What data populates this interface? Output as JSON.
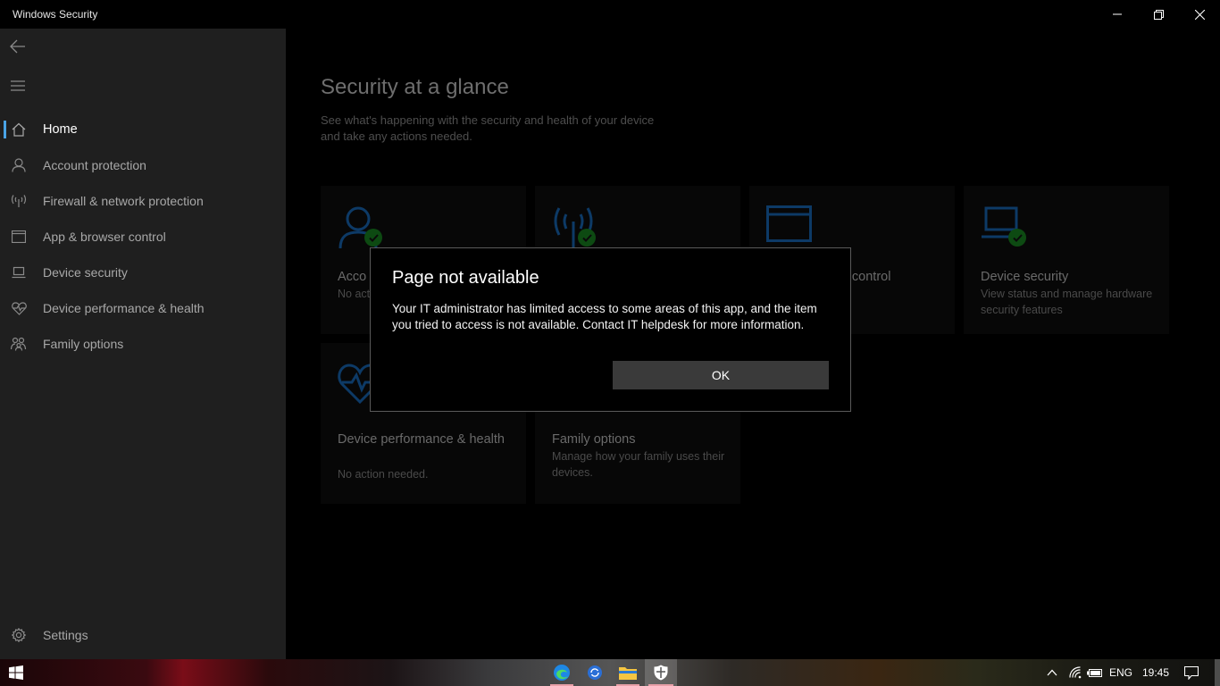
{
  "window": {
    "title": "Windows Security"
  },
  "sidebar": {
    "items": [
      {
        "label": "Home",
        "icon": "home-icon",
        "active": true
      },
      {
        "label": "Account protection",
        "icon": "person-icon"
      },
      {
        "label": "Firewall & network protection",
        "icon": "antenna-icon"
      },
      {
        "label": "App & browser control",
        "icon": "browser-window-icon"
      },
      {
        "label": "Device security",
        "icon": "laptop-icon"
      },
      {
        "label": "Device performance & health",
        "icon": "heart-pulse-icon"
      },
      {
        "label": "Family options",
        "icon": "family-icon"
      }
    ],
    "settings_label": "Settings"
  },
  "main": {
    "title": "Security at a glance",
    "subtitle": "See what's happening with the security and health of your device and take any actions needed.",
    "tiles": [
      {
        "name": "Acco",
        "desc": "No act",
        "icon": "person-icon",
        "status": "ok"
      },
      {
        "name": "",
        "desc": "",
        "icon": "antenna-icon",
        "status": "ok"
      },
      {
        "name": "er control",
        "desc": "",
        "icon": "browser-window-icon"
      },
      {
        "name": "Device security",
        "desc": "View status and manage hardware security features",
        "icon": "laptop-icon",
        "status": "ok"
      },
      {
        "name": "Device performance & health",
        "desc": "No action needed.",
        "icon": "heart-pulse-icon"
      },
      {
        "name": "Family options",
        "desc": "Manage how your family uses their devices.",
        "icon": "family-icon"
      }
    ]
  },
  "dialog": {
    "title": "Page not available",
    "message": "Your IT administrator has limited access to some areas of this app, and the item you tried to access is not available. Contact IT helpdesk for more information.",
    "ok_label": "OK"
  },
  "taskbar": {
    "language": "ENG",
    "time": "19:45"
  },
  "colors": {
    "accent": "#4aa3e6",
    "sidebar_bg": "#1f1f1f",
    "check_green": "#107c10"
  }
}
